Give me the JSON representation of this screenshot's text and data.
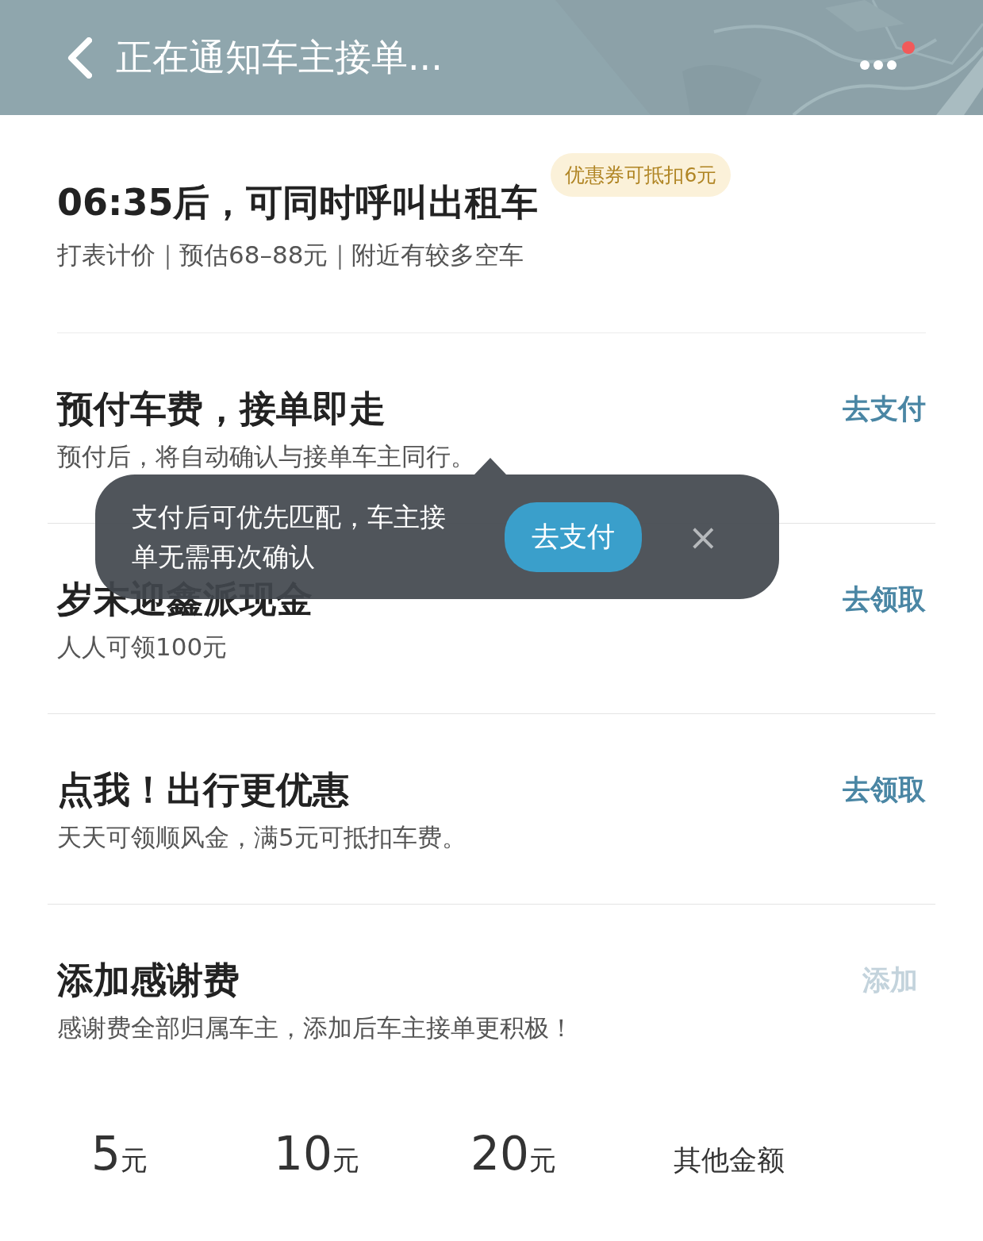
{
  "header": {
    "title": "正在通知车主接单...",
    "notification": true
  },
  "taxi": {
    "title": "06:35后，可同时呼叫出租车",
    "badge": "优惠券可抵扣6元",
    "details": "打表计价｜预估68–88元｜附近有较多空车"
  },
  "sections": [
    {
      "title": "预付车费，接单即走",
      "subtitle": "预付后，将自动确认与接单车主同行。",
      "action": {
        "label": "去支付",
        "disabled": false
      }
    },
    {
      "title": "岁末迎鑫派现金",
      "subtitle": "人人可领100元",
      "action": {
        "label": "去领取",
        "disabled": false
      }
    },
    {
      "title": "点我！出行更优惠",
      "subtitle": "天天可领顺风金，满5元可抵扣车费。",
      "action": {
        "label": "去领取",
        "disabled": false
      }
    },
    {
      "title": "添加感谢费",
      "subtitle": "感谢费全部归属车主，添加后车主接单更积极！",
      "action": {
        "label": "添加",
        "disabled": true
      }
    }
  ],
  "amounts": [
    {
      "kind": "preset",
      "amount": "5",
      "unit": "元"
    },
    {
      "kind": "preset",
      "amount": "10",
      "unit": "元"
    },
    {
      "kind": "preset",
      "amount": "20",
      "unit": "元"
    },
    {
      "kind": "custom",
      "label": "其他金额"
    }
  ],
  "tooltip": {
    "text": "支付后可优先匹配，车主接单无需再次确认",
    "button": "去支付",
    "close": "×"
  }
}
